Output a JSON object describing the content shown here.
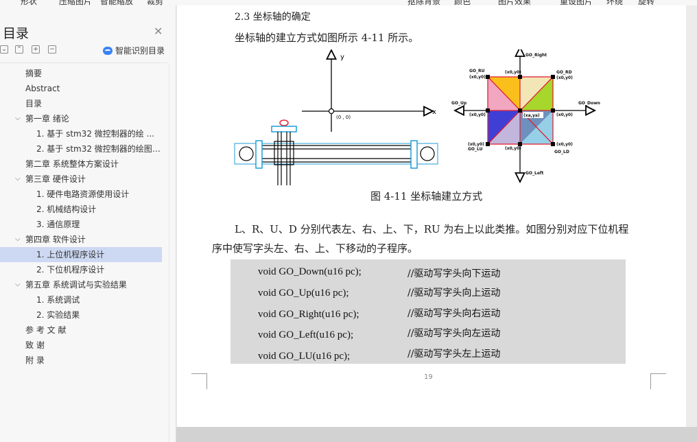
{
  "toolbar": {
    "items": [
      "形状",
      "压缩图片",
      "智能缩放",
      "裁剪",
      "抠除背景",
      "颜色",
      "图片效果",
      "重设图片",
      "环绕",
      "旋转"
    ]
  },
  "sidebar": {
    "title": "目录",
    "smart_label": "智能识别目录",
    "toc": [
      {
        "label": "摘要",
        "level": 0
      },
      {
        "label": "Abstract",
        "level": 0
      },
      {
        "label": "目录",
        "level": 0
      },
      {
        "label": "第一章 绪论",
        "level": 0,
        "expanded": true
      },
      {
        "label": "1. 基于 stm32 微控制器的绘 ...",
        "level": 1
      },
      {
        "label": "2. 基于 stm32 微控制器的绘图 ...",
        "level": 1
      },
      {
        "label": "第二章 系统整体方案设计",
        "level": 0
      },
      {
        "label": "第三章 硬件设计",
        "level": 0,
        "expanded": true
      },
      {
        "label": "1. 硬件电路资源使用设计",
        "level": 1
      },
      {
        "label": "2. 机械结构设计",
        "level": 1
      },
      {
        "label": "3. 通信原理",
        "level": 1
      },
      {
        "label": "第四章 软件设计",
        "level": 0,
        "expanded": true
      },
      {
        "label": "1. 上位机程序设计",
        "level": 1,
        "selected": true
      },
      {
        "label": "2. 下位机程序设计",
        "level": 1
      },
      {
        "label": "第五章 系统调试与实验结果",
        "level": 0,
        "expanded": true
      },
      {
        "label": "1. 系统调试",
        "level": 1
      },
      {
        "label": "2. 实验结果",
        "level": 1
      },
      {
        "label": "参 考 文 献",
        "level": 0
      },
      {
        "label": "致 谢",
        "level": 0
      },
      {
        "label": "附 录",
        "level": 0
      }
    ]
  },
  "document": {
    "heading_fragment": "2.3 坐标轴的确定",
    "intro": "坐标轴的建立方式如图所示 4-11 所示。",
    "caption": "图 4-11 坐标轴建立方式",
    "para_line1": "L、R、U、D 分别代表左、右、上、下，RU 为右上以此类推。如图分别对应下位机程",
    "para_line2": "序中使写字头左、右、上、下移动的子程序。",
    "code": [
      {
        "fn": "void GO_Down(u16 pc);",
        "comment": "//驱动写字头向下运动"
      },
      {
        "fn": "void GO_Up(u16 pc);",
        "comment": "//驱动写字头向上运动"
      },
      {
        "fn": "void GO_Right(u16 pc);",
        "comment": "//驱动写字头向右运动"
      },
      {
        "fn": "void GO_Left(u16 pc);",
        "comment": "//驱动写字头向左运动"
      },
      {
        "fn": "void GO_LU(u16 pc);",
        "comment": "//驱动写字头左上运动"
      }
    ],
    "page_number": "19"
  },
  "figure_left": {
    "axis_y": "y",
    "axis_x": "x",
    "origin": "(0 , 0)"
  },
  "figure_right": {
    "go_right": "GO_Right",
    "go_left": "GO_Left",
    "go_up": "GO_Up",
    "go_down": "GO_Down",
    "go_ru": "GO_RU",
    "go_rd": "GO_RD",
    "go_lu": "GO_LU",
    "go_ld": "GO_LD",
    "coord": "(x0,y0)",
    "center": "(xa,ya)"
  },
  "colors": {
    "selection": "#cdd9f3",
    "code_bg": "#d9d9d9",
    "accent": "#3b82f6"
  }
}
